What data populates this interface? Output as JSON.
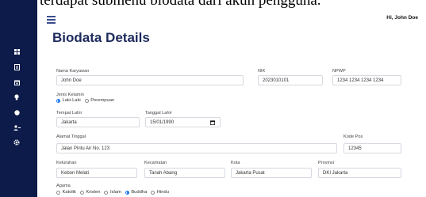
{
  "caption": "terdapat submenu biodata dari akun pengguna.",
  "header": {
    "greeting": "Hi, John Doe"
  },
  "page": {
    "title": "Biodata Details"
  },
  "sidebar": {
    "items": [
      {
        "icon": "grid-icon"
      },
      {
        "icon": "document-icon"
      },
      {
        "icon": "calendar-icon"
      },
      {
        "icon": "lightbulb-icon"
      },
      {
        "icon": "circle-icon"
      },
      {
        "icon": "users-icon"
      },
      {
        "icon": "gear-icon"
      }
    ]
  },
  "form": {
    "nama_karyawan": {
      "label": "Nama Karyawan",
      "value": "John Doe"
    },
    "nik": {
      "label": "NIK",
      "value": "2023010101"
    },
    "npwp": {
      "label": "NPWP",
      "value": "1234 1234 1234 1234"
    },
    "jenis_kelamin": {
      "label": "Jenis Kelamin",
      "options": [
        "Laki-Laki",
        "Perempuan"
      ],
      "selected": "Laki-Laki"
    },
    "tempat_lahir": {
      "label": "Tempat Lahir",
      "value": "Jakarta"
    },
    "tanggal_lahir": {
      "label": "Tanggal Lahir",
      "value": "15/01/1990"
    },
    "alamat_tinggal": {
      "label": "Alamat Tinggal",
      "value": "Jalan Pintu Air No. 123"
    },
    "kode_pos": {
      "label": "Kode Pos",
      "value": "12345"
    },
    "kelurahan": {
      "label": "Kelurahan",
      "value": "Kebon Melati"
    },
    "kecamatan": {
      "label": "Kecamatan",
      "value": "Tanah Abang"
    },
    "kota": {
      "label": "Kota",
      "value": "Jakarta Pusat"
    },
    "provinsi": {
      "label": "Provinsi",
      "value": "DKI Jakarta"
    },
    "agama": {
      "label": "Agama",
      "options": [
        "Katolik",
        "Kristen",
        "Islam",
        "Buddha",
        "Hindu"
      ],
      "selected": "Buddha"
    }
  }
}
